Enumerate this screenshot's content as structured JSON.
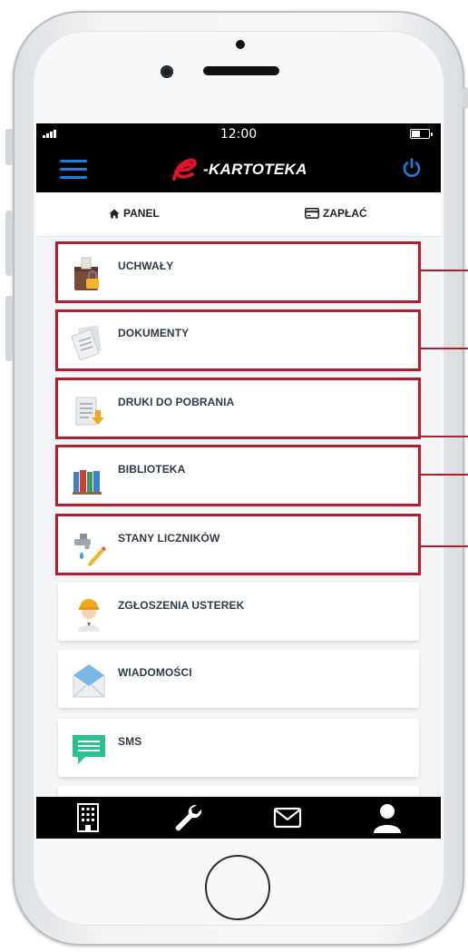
{
  "status": {
    "time": "12:00"
  },
  "header": {
    "brand": "-KARTOTEKA"
  },
  "tabs": {
    "panel": "PANEL",
    "pay": "ZAPŁAĆ"
  },
  "menu": [
    {
      "label": "UCHWAŁY",
      "icon": "archive-box-icon",
      "highlighted": true
    },
    {
      "label": "DOKUMENTY",
      "icon": "documents-icon",
      "highlighted": true
    },
    {
      "label": "DRUKI DO POBRANIA",
      "icon": "download-document-icon",
      "highlighted": true
    },
    {
      "label": "BIBLIOTEKA",
      "icon": "books-icon",
      "highlighted": true
    },
    {
      "label": "STANY LICZNIKÓW",
      "icon": "water-tap-icon",
      "highlighted": true
    },
    {
      "label": "ZGŁOSZENIA USTEREK",
      "icon": "worker-icon",
      "highlighted": false
    },
    {
      "label": "WIADOMOŚCI",
      "icon": "envelope-icon",
      "highlighted": false
    },
    {
      "label": "SMS",
      "icon": "sms-icon",
      "highlighted": false
    }
  ],
  "bottom_nav": [
    "building-icon",
    "wrench-icon",
    "mail-icon",
    "user-icon"
  ],
  "colors": {
    "accent": "#1e7ee0",
    "brand_red": "#e1122b",
    "highlight": "#b21e2e",
    "bar": "#000000"
  }
}
